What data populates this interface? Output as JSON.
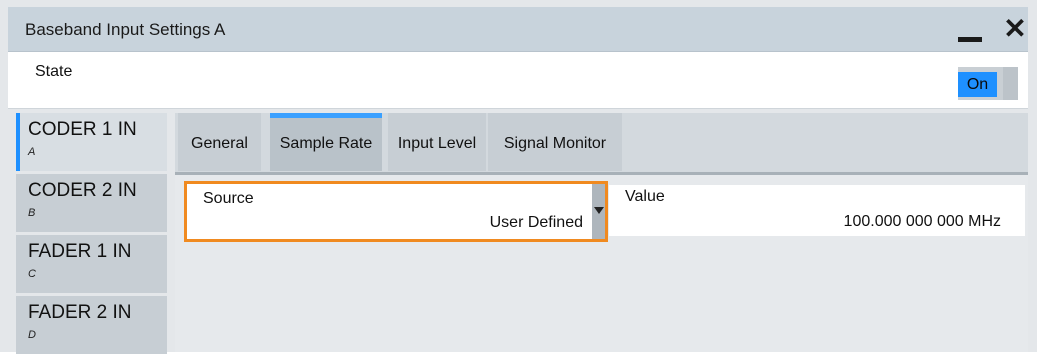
{
  "window": {
    "title": "Baseband Input Settings A"
  },
  "state": {
    "label": "State",
    "toggle_label": "On"
  },
  "sidebar": {
    "items": [
      {
        "label": "CODER 1 IN",
        "sub": "A"
      },
      {
        "label": "CODER 2 IN",
        "sub": "B"
      },
      {
        "label": "FADER 1 IN",
        "sub": "C"
      },
      {
        "label": "FADER 2 IN",
        "sub": "D"
      }
    ]
  },
  "tabs": [
    {
      "label": "General"
    },
    {
      "label": "Sample Rate"
    },
    {
      "label": "Input Level"
    },
    {
      "label": "Signal Monitor"
    }
  ],
  "source": {
    "label": "Source",
    "value": "User Defined"
  },
  "value_field": {
    "label": "Value",
    "value": "100.000 000 000 MHz"
  },
  "colors": {
    "accent": "#1e90ff",
    "focus": "#f08a20"
  }
}
